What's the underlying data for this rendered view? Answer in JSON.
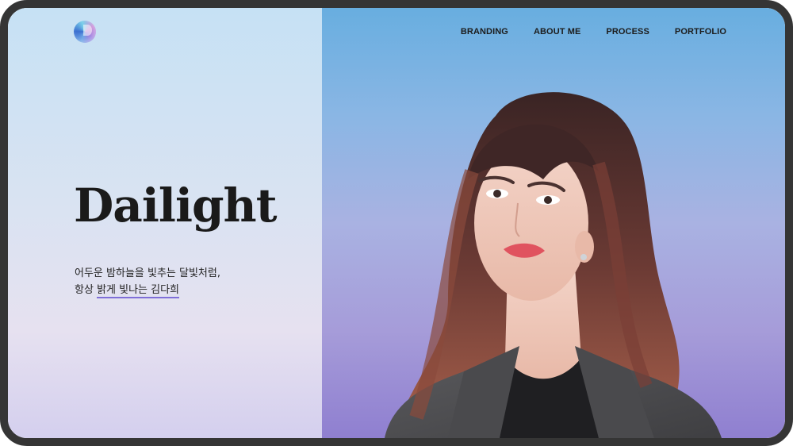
{
  "brand": {
    "title": "Dailight",
    "logo_icon": "gradient-orb-logo-icon"
  },
  "nav": {
    "items": [
      {
        "label": "BRANDING"
      },
      {
        "label": "ABOUT ME"
      },
      {
        "label": "PROCESS"
      },
      {
        "label": "PORTFOLIO"
      }
    ]
  },
  "hero": {
    "line1": "어두운 밤하늘을 빛추는 달빛처럼,",
    "line2_prefix": "항상 ",
    "line2_highlight": "밝게 빛나는 김다희",
    "portrait_icon": "woman-portrait-image"
  },
  "colors": {
    "accent_underline": "#7f6fd8",
    "left_panel_top": "#c6e1f4",
    "right_panel_top": "#68aee0",
    "right_panel_bottom": "#8f7fd0",
    "text": "#1a1a1a",
    "device_frame": "#353535"
  }
}
